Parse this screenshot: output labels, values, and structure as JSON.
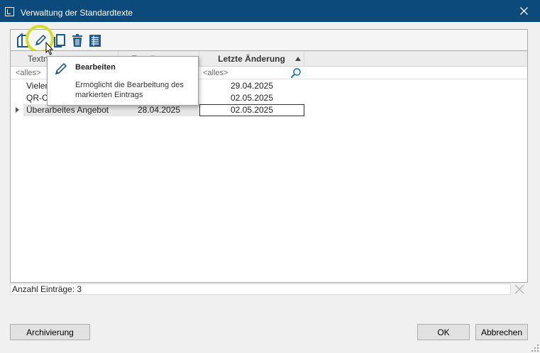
{
  "window": {
    "title": "Verwaltung der Standardtexte"
  },
  "toolbar": {
    "buttons": [
      "new-document",
      "edit",
      "copy",
      "delete",
      "archive-list"
    ]
  },
  "grid": {
    "columns": [
      "Textn",
      "Erstellt am",
      "Letzte Änderung"
    ],
    "filters": [
      "<alles>",
      "",
      "<alles>"
    ],
    "rows": [
      {
        "name": "Vielen",
        "created": "",
        "modified": "29.04.2025"
      },
      {
        "name": "QR-Co",
        "created": "",
        "modified": "02.05.2025"
      },
      {
        "name": "Überarbeites Angebot",
        "created": "28.04.2025",
        "modified": "02.05.2025"
      }
    ]
  },
  "status": {
    "count_text": "Anzahl Einträge: 3"
  },
  "tooltip": {
    "title": "Bearbeiten",
    "description": "Ermöglicht die Bearbeitung des markierten Eintrags"
  },
  "footer": {
    "archive_label": "Archivierung",
    "ok_label": "OK",
    "cancel_label": "Abbrechen"
  },
  "colors": {
    "titlebar": "#0b4a7a",
    "highlight": "#d8dc2a",
    "accent": "#2b6cb0"
  }
}
